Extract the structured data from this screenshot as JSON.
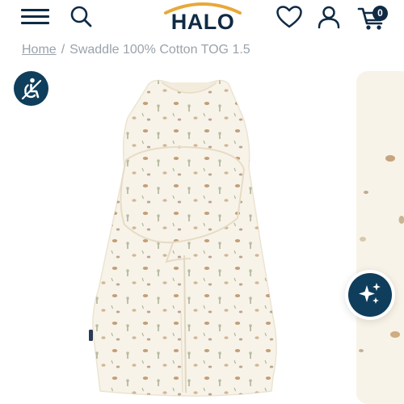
{
  "header": {
    "menu_icon": "hamburger-menu-icon",
    "search_icon": "search-icon",
    "logo_text": "HALO",
    "wishlist_icon": "heart-icon",
    "account_icon": "user-icon",
    "cart_icon": "cart-icon",
    "cart_count": "0"
  },
  "breadcrumb": {
    "home": "Home",
    "separator": "/",
    "current": "Swaddle 100% Cotton TOG 1.5"
  },
  "accessibility": {
    "icon": "accessibility-icon"
  },
  "gallery": {
    "main_image": "product-image-swaddle",
    "next_image": "product-image-detail"
  },
  "assistant": {
    "icon": "sparkles-icon"
  },
  "colors": {
    "navy": "#0f2a44",
    "accent": "#0f3d5c",
    "logo_arc": "#e8a838",
    "fabric": "#f8f3e8"
  }
}
